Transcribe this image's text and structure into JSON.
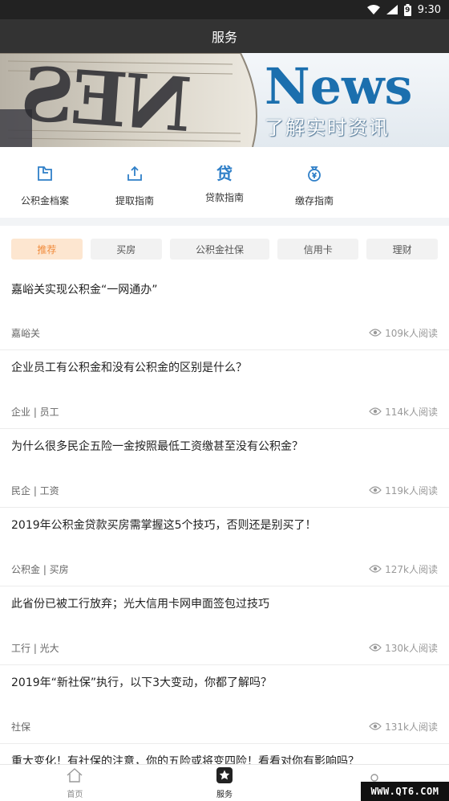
{
  "status_bar": {
    "time": "9:30",
    "battery_level": "9"
  },
  "header": {
    "title": "服务"
  },
  "banner": {
    "headline": "News",
    "subtitle": "了解实时资讯",
    "paper_fragment": "NES",
    "accent_color": "#1b6fae"
  },
  "quick_links": [
    {
      "label": "公积金档案",
      "icon": "folder-icon"
    },
    {
      "label": "提取指南",
      "icon": "upload-icon"
    },
    {
      "label": "贷款指南",
      "icon": "loan-icon"
    },
    {
      "label": "缴存指南",
      "icon": "money-bag-icon"
    }
  ],
  "tabs": [
    {
      "label": "推荐",
      "active": true
    },
    {
      "label": "买房",
      "active": false
    },
    {
      "label": "公积金社保",
      "active": false
    },
    {
      "label": "信用卡",
      "active": false
    },
    {
      "label": "理财",
      "active": false
    }
  ],
  "articles": [
    {
      "title": "嘉峪关实现公积金“一网通办”",
      "tags": "嘉峪关",
      "views": "109k人阅读"
    },
    {
      "title": "企业员工有公积金和没有公积金的区别是什么？",
      "tags": "企业 | 员工",
      "views": "114k人阅读"
    },
    {
      "title": "为什么很多民企五险一金按照最低工资缴甚至没有公积金？",
      "tags": "民企 | 工资",
      "views": "119k人阅读"
    },
    {
      "title": "2019年公积金贷款买房需掌握这5个技巧，否则还是别买了！",
      "tags": "公积金 | 买房",
      "views": "127k人阅读"
    },
    {
      "title": "此省份已被工行放弃；光大信用卡网申面签包过技巧",
      "tags": "工行 | 光大",
      "views": "130k人阅读"
    },
    {
      "title": "2019年“新社保”执行，以下3大变动，你都了解吗？",
      "tags": "社保",
      "views": "131k人阅读"
    },
    {
      "title": "重大变化！有社保的注意，你的五险或将变四险！看看对你有影响吗？",
      "tags": "",
      "views": ""
    }
  ],
  "bottom_nav": [
    {
      "label": "首页",
      "icon": "home-icon",
      "active": false
    },
    {
      "label": "服务",
      "icon": "star-icon",
      "active": true
    },
    {
      "label": "",
      "icon": "user-icon",
      "active": false
    }
  ],
  "watermark": "WWW.QT6.COM",
  "colors": {
    "title_bar": "#333333",
    "quick_icon": "#2f7fc8",
    "active_tab_bg": "#fde6d0",
    "active_tab_text": "#f08a3a"
  }
}
